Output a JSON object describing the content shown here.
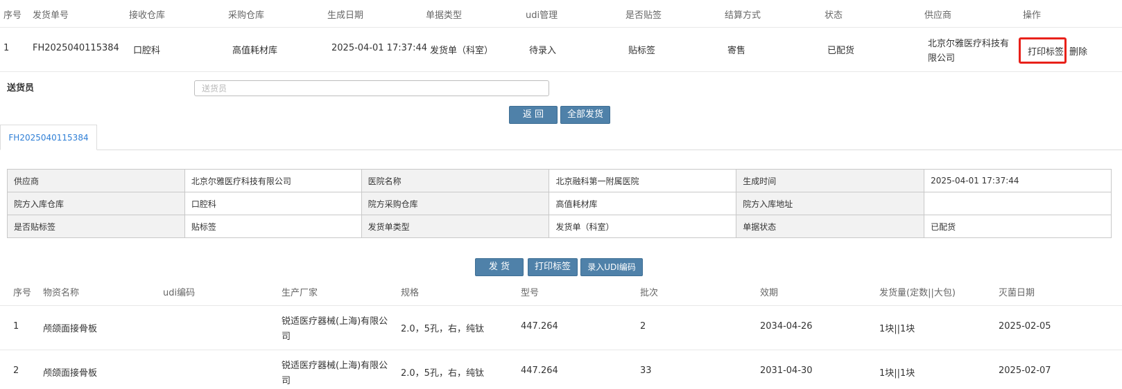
{
  "orders_table": {
    "columns": [
      "序号",
      "发货单号",
      "接收仓库",
      "采购仓库",
      "生成日期",
      "单据类型",
      "udi管理",
      "是否贴签",
      "结算方式",
      "状态",
      "供应商",
      "操作"
    ],
    "row": {
      "index": "1",
      "order_no": "FH2025040115384",
      "receive_wh": "口腔科",
      "purchase_wh": "高值耗材库",
      "date": "2025-04-01 17:37:44",
      "doc_type": "发货单（科室）",
      "udi": "待录入",
      "label_status": "贴标签",
      "settlement": "寄售",
      "status": "已配货",
      "supplier_l1": "北京尔雅医疗科技有",
      "supplier_l2": "限公司",
      "print_label": "打印标签",
      "delete": "删除"
    }
  },
  "courier": {
    "label": "送货员",
    "placeholder": "送货员"
  },
  "actions": {
    "back": "返 回",
    "ship_all": "全部发货"
  },
  "tab": {
    "label": "FH2025040115384"
  },
  "info": {
    "r1": [
      "供应商",
      "北京尔雅医疗科技有限公司",
      "医院名称",
      "北京融科第一附属医院",
      "生成时间",
      "2025-04-01 17:37:44"
    ],
    "r2": [
      "院方入库仓库",
      "口腔科",
      "院方采购仓库",
      "高值耗材库",
      "院方入库地址",
      ""
    ],
    "r3": [
      "是否贴标签",
      "贴标签",
      "发货单类型",
      "发货单（科室）",
      "单据状态",
      "已配货"
    ]
  },
  "item_actions": {
    "ship": "发 货",
    "print": "打印标签",
    "udi": "录入UDI编码"
  },
  "items_table": {
    "columns": [
      "序号",
      "物资名称",
      "udi编码",
      "生产厂家",
      "规格",
      "型号",
      "批次",
      "效期",
      "发货量(定数||大包)",
      "灭菌日期"
    ],
    "rows": [
      {
        "index": "1",
        "name": "颅颌面接骨板",
        "udi": "",
        "mfr_l1": "锐适医疗器械(上海)有限公",
        "mfr_l2": "司",
        "spec": "2.0，5孔，右，纯钛",
        "model": "447.264",
        "batch": "2",
        "expiry": "2034-04-26",
        "qty": "1块||1块",
        "sterile": "2025-02-05"
      },
      {
        "index": "2",
        "name": "颅颌面接骨板",
        "udi": "",
        "mfr_l1": "锐适医疗器械(上海)有限公",
        "mfr_l2": "司",
        "spec": "2.0，5孔，右，纯钛",
        "model": "447.264",
        "batch": "33",
        "expiry": "2031-04-30",
        "qty": "1块||1块",
        "sterile": "2025-02-07"
      }
    ]
  },
  "colors": {
    "button": "#4f81a9",
    "link": "#2f7fd6",
    "highlight": "#e8211a"
  }
}
